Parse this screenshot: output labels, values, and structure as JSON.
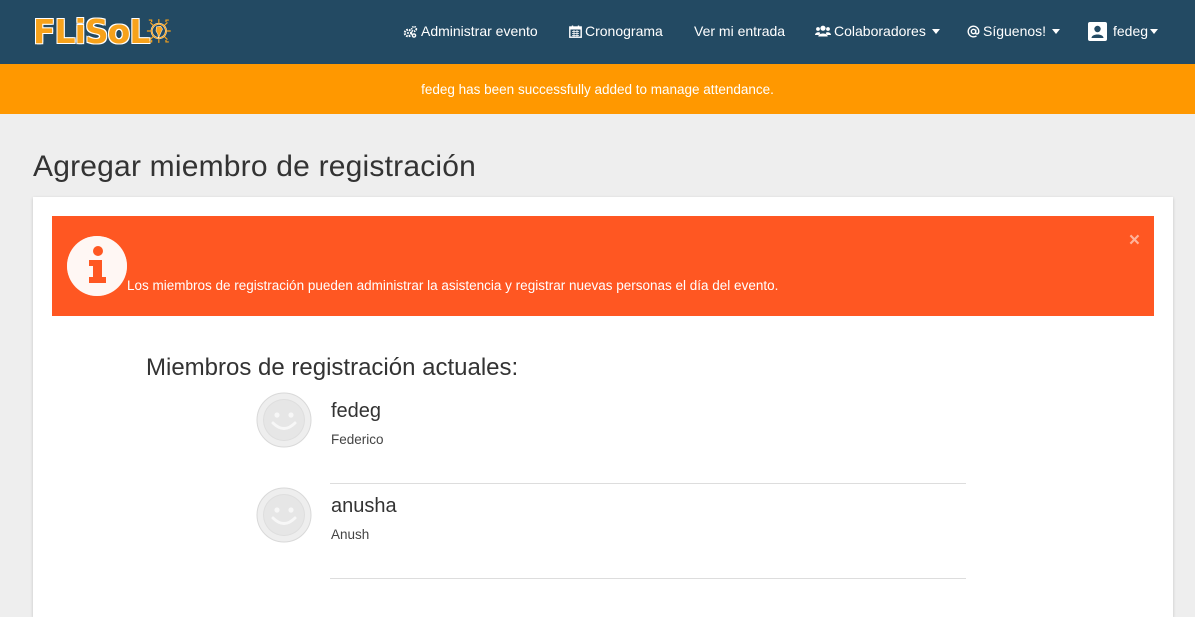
{
  "brand": {
    "logo_text": "FLiSoL"
  },
  "navbar": {
    "manage_event": {
      "label": "Administrar evento",
      "icon": "cogs-icon"
    },
    "schedule": {
      "label": "Cronograma",
      "icon": "calendar-icon"
    },
    "my_ticket": {
      "label": "Ver mi entrada"
    },
    "collaborators": {
      "label": "Colaboradores",
      "icon": "users-icon"
    },
    "follow_us": {
      "label": "Síguenos!",
      "icon": "at-icon"
    },
    "user": {
      "label": "fedeg",
      "icon": "account-box-icon"
    }
  },
  "flash": {
    "message": "fedeg has been successfully added to manage attendance."
  },
  "page": {
    "title": "Agregar miembro de registración"
  },
  "alert": {
    "message": "Los miembros de registración pueden administrar la asistencia y registrar nuevas personas el día del evento.",
    "close": "×"
  },
  "members": {
    "title": "Miembros de registración actuales:",
    "list": [
      {
        "username": "fedeg",
        "name": "Federico"
      },
      {
        "username": "anusha",
        "name": "Anush"
      }
    ]
  },
  "colors": {
    "navbar": "#234a63",
    "flash": "#ff9800",
    "alert": "#ff5722",
    "brand": "#f7a21b",
    "background": "#eeeeee"
  }
}
